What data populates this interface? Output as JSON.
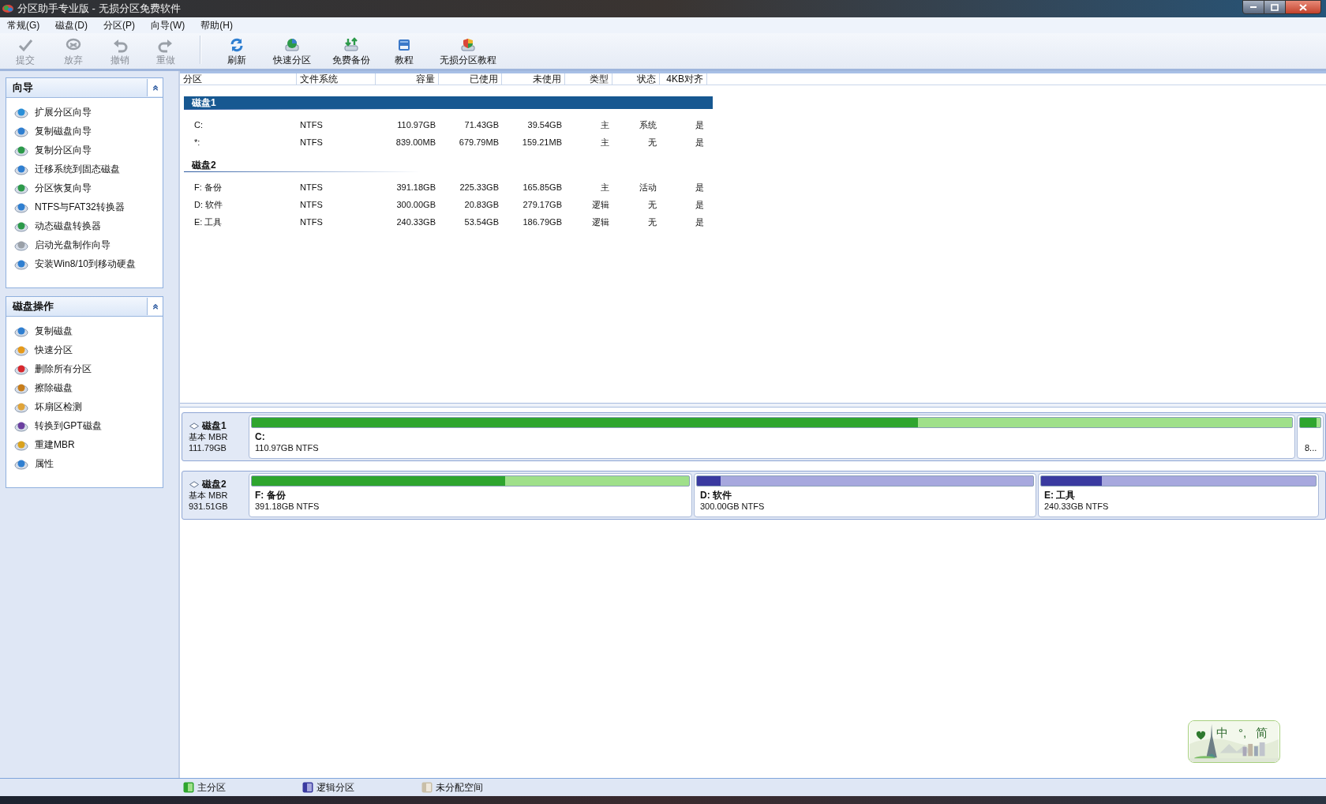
{
  "window": {
    "title": "分区助手专业版 - 无损分区免费软件"
  },
  "menu": [
    "常规(G)",
    "磁盘(D)",
    "分区(P)",
    "向导(W)",
    "帮助(H)"
  ],
  "toolbar": [
    {
      "label": "提交",
      "disabled": true
    },
    {
      "label": "放弃",
      "disabled": true
    },
    {
      "label": "撤销",
      "disabled": true
    },
    {
      "label": "重做",
      "disabled": true
    },
    {
      "label": "刷新",
      "disabled": false
    },
    {
      "label": "快速分区",
      "disabled": false
    },
    {
      "label": "免费备份",
      "disabled": false
    },
    {
      "label": "教程",
      "disabled": false
    },
    {
      "label": "无损分区教程",
      "disabled": false
    }
  ],
  "sidebar": [
    {
      "title": "向导",
      "expanded": true,
      "items": [
        "扩展分区向导",
        "复制磁盘向导",
        "复制分区向导",
        "迁移系统到固态磁盘",
        "分区恢复向导",
        "NTFS与FAT32转换器",
        "动态磁盘转换器",
        "启动光盘制作向导",
        "安装Win8/10到移动硬盘"
      ]
    },
    {
      "title": "磁盘操作",
      "expanded": true,
      "items": [
        "复制磁盘",
        "快速分区",
        "删除所有分区",
        "擦除磁盘",
        "坏扇区检测",
        "转换到GPT磁盘",
        "重建MBR",
        "属性"
      ]
    }
  ],
  "table": {
    "columns": [
      "分区",
      "文件系统",
      "容量",
      "已使用",
      "未使用",
      "类型",
      "状态",
      "4KB对齐"
    ],
    "groups": [
      {
        "name": "磁盘1",
        "selected": true,
        "rows": [
          [
            "C:",
            "NTFS",
            "110.97GB",
            "71.43GB",
            "39.54GB",
            "主",
            "系统",
            "是"
          ],
          [
            "*:",
            "NTFS",
            "839.00MB",
            "679.79MB",
            "159.21MB",
            "主",
            "无",
            "是"
          ]
        ]
      },
      {
        "name": "磁盘2",
        "selected": false,
        "rows": [
          [
            "F: 备份",
            "NTFS",
            "391.18GB",
            "225.33GB",
            "165.85GB",
            "主",
            "活动",
            "是"
          ],
          [
            "D: 软件",
            "NTFS",
            "300.00GB",
            "20.83GB",
            "279.17GB",
            "逻辑",
            "无",
            "是"
          ],
          [
            "E: 工具",
            "NTFS",
            "240.33GB",
            "53.54GB",
            "186.79GB",
            "逻辑",
            "无",
            "是"
          ]
        ]
      }
    ]
  },
  "disk_map": [
    {
      "name": "磁盘1",
      "type": "基本 MBR",
      "size": "111.79GB",
      "partitions": [
        {
          "kind": "primary",
          "label": "C:",
          "detail": "110.97GB NTFS",
          "level": 0.64
        },
        {
          "kind": "primary",
          "detail": "8...",
          "level": 0.81
        }
      ]
    },
    {
      "name": "磁盘2",
      "type": "基本 MBR",
      "size": "931.51GB",
      "partitions": [
        {
          "kind": "primary",
          "label": "F: 备份",
          "detail": "391.18GB NTFS",
          "level": 0.58
        },
        {
          "kind": "logical",
          "label": "D: 软件",
          "detail": "300.00GB NTFS",
          "level": 0.07
        },
        {
          "kind": "logical",
          "label": "E: 工具",
          "detail": "240.33GB NTFS",
          "level": 0.22
        }
      ]
    }
  ],
  "legend": [
    {
      "kind": "primary",
      "label": "主分区"
    },
    {
      "kind": "logical",
      "label": "逻辑分区"
    },
    {
      "kind": "unallocated",
      "label": "未分配空间"
    }
  ],
  "ime_bar": {
    "mode": "中",
    "punctuation": "°,",
    "script": "简"
  }
}
